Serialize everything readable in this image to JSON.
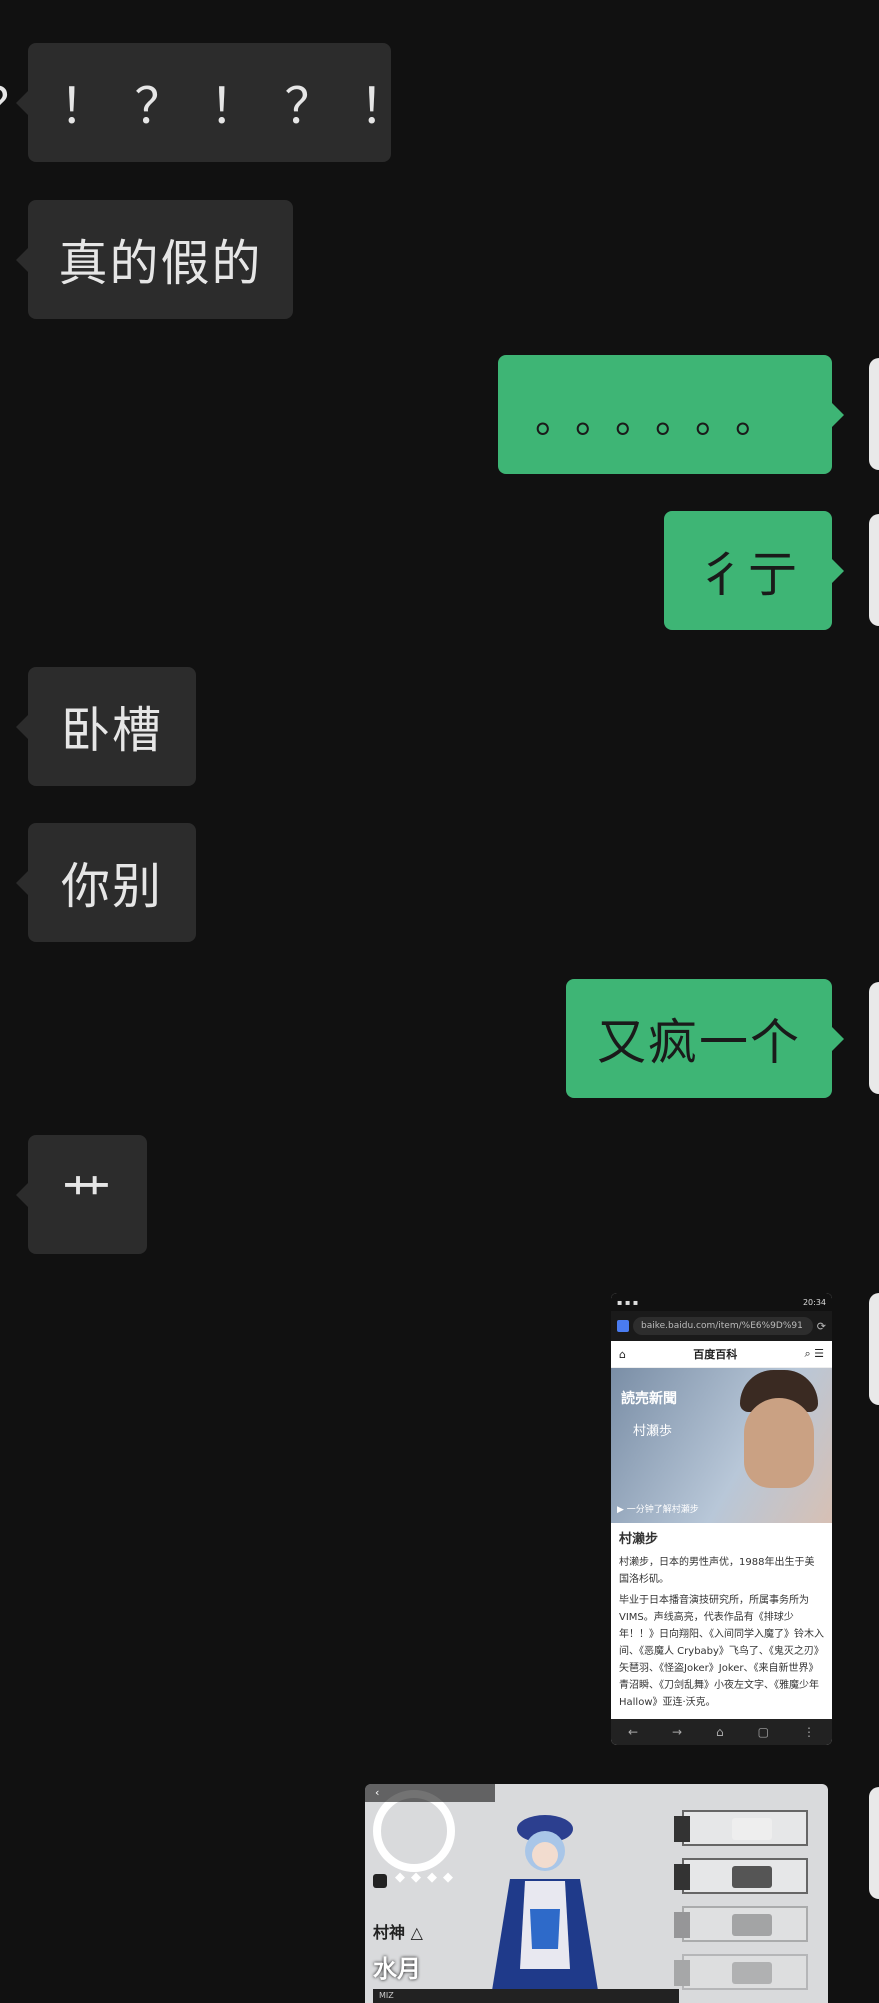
{
  "messages": [
    {
      "side": "left",
      "text": "？！？！？！"
    },
    {
      "side": "left",
      "text": "真的假的"
    },
    {
      "side": "right",
      "text": "。。。。。。"
    },
    {
      "side": "right",
      "text": "彳亍"
    },
    {
      "side": "left",
      "text": "卧槽"
    },
    {
      "side": "left",
      "text": "你别"
    },
    {
      "side": "right",
      "text": "又疯一个"
    },
    {
      "side": "left",
      "text": "艹"
    }
  ],
  "screenshot1": {
    "url": "baike.baidu.com/item/%E6%9D%91",
    "site": "百度百科",
    "hero_title": "読売新聞",
    "hero_name": "村瀬歩",
    "hero_caption": "一分钟了解村瀬步",
    "heading": "村濑步",
    "para1": "村濑步，日本的男性声优，1988年出生于美国洛杉矶。",
    "para2": "毕业于日本播音演技研究所，所属事务所为VIMS。声线高亮，代表作品有《排球少年！！》日向翔阳、《入间同学入魔了》铃木入间、《恶魔人 Crybaby》飞鸟了、《鬼灭之刃》矢琶羽、《怪盗Joker》Joker、《来自新世界》青沼瞬、《刀剑乱舞》小夜左文字、《雅魔少年Hallow》亚连·沃克。",
    "time": "20:34"
  },
  "screenshot2": {
    "name_small": "村神 △",
    "name_big": "水月",
    "roman": "MIZ"
  }
}
